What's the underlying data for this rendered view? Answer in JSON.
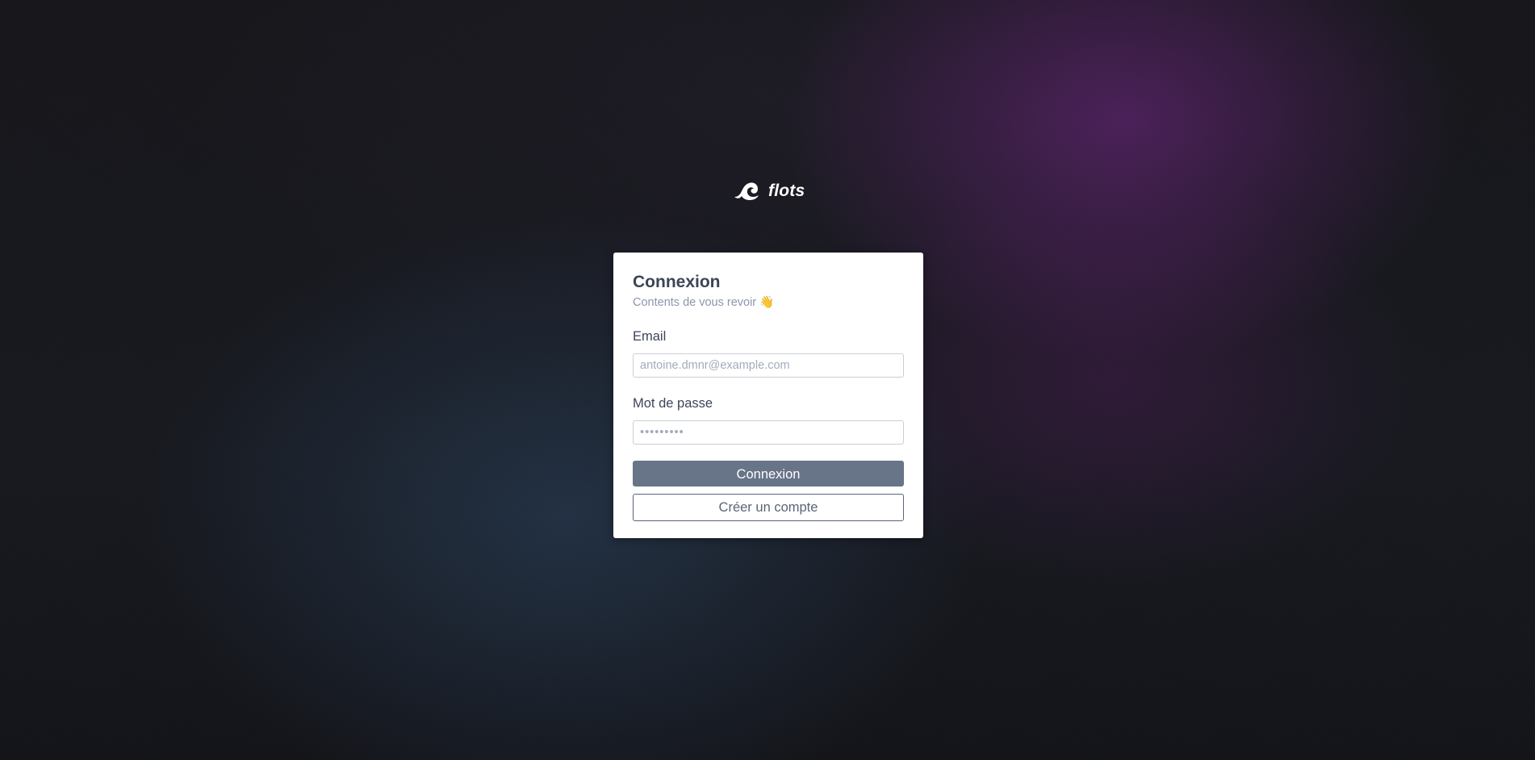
{
  "brand": {
    "name": "flots",
    "icon": "wave-logo-icon"
  },
  "login": {
    "title": "Connexion",
    "subtitle": "Contents de vous revoir 👋",
    "email": {
      "label": "Email",
      "placeholder": "antoine.dmnr@example.com",
      "value": ""
    },
    "password": {
      "label": "Mot de passe",
      "placeholder": "•••••••••",
      "value": ""
    },
    "submit_label": "Connexion",
    "register_label": "Créer un compte"
  },
  "colors": {
    "primary_button": "#687487",
    "text": "#3c4556",
    "muted_text": "#8a97ab",
    "background": "#15161b",
    "accent_purple": "#78288c",
    "accent_blue": "#2d4664"
  }
}
